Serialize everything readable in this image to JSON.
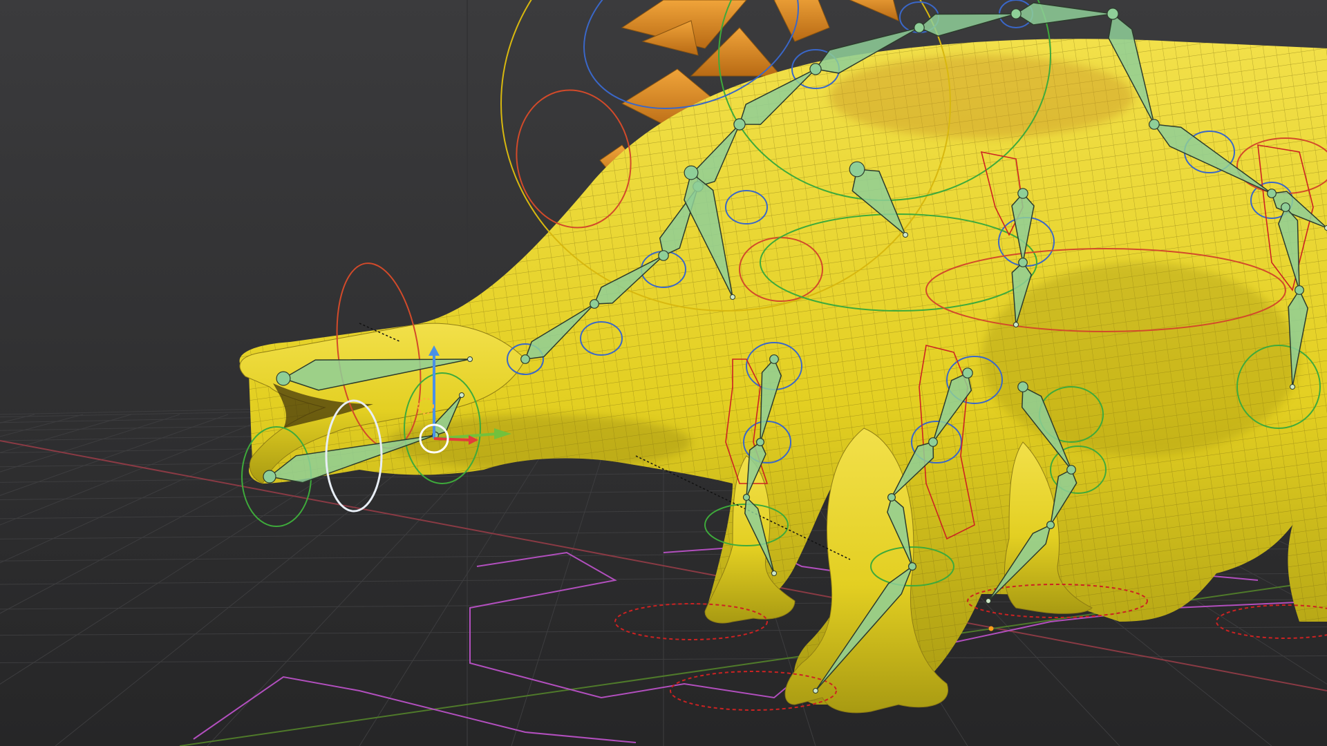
{
  "viewport": {
    "background_top": "#3b3b3d",
    "background_bottom": "#262627",
    "grid_color": "#3d3d3f",
    "axis_x_color": "#8a3a44",
    "axis_y_color": "#4f7a2a"
  },
  "model": {
    "body_color": "#e3d32a",
    "plate_color": "#d98a1d",
    "wire_color": "#8f7d14",
    "bone_color": "#8fcf98"
  },
  "rig": {
    "bone_outline": "#2c3b2c",
    "fk_control_color": "#3a67c8",
    "ik_control_color": "#3eaa3b",
    "ik_alt_color": "#d24a2a",
    "foot_control_color": "#cc2222",
    "path_color": "#b24fbe",
    "selected_color": "#e8eef6",
    "root_color": "#d8b80f"
  },
  "gizmo": {
    "x_axis_color": "#e23b3b",
    "y_axis_color": "#72c13c",
    "z_axis_color": "#4a90e6",
    "origin_color": "#ffffff",
    "pivot_color": "#ff9c1a"
  }
}
